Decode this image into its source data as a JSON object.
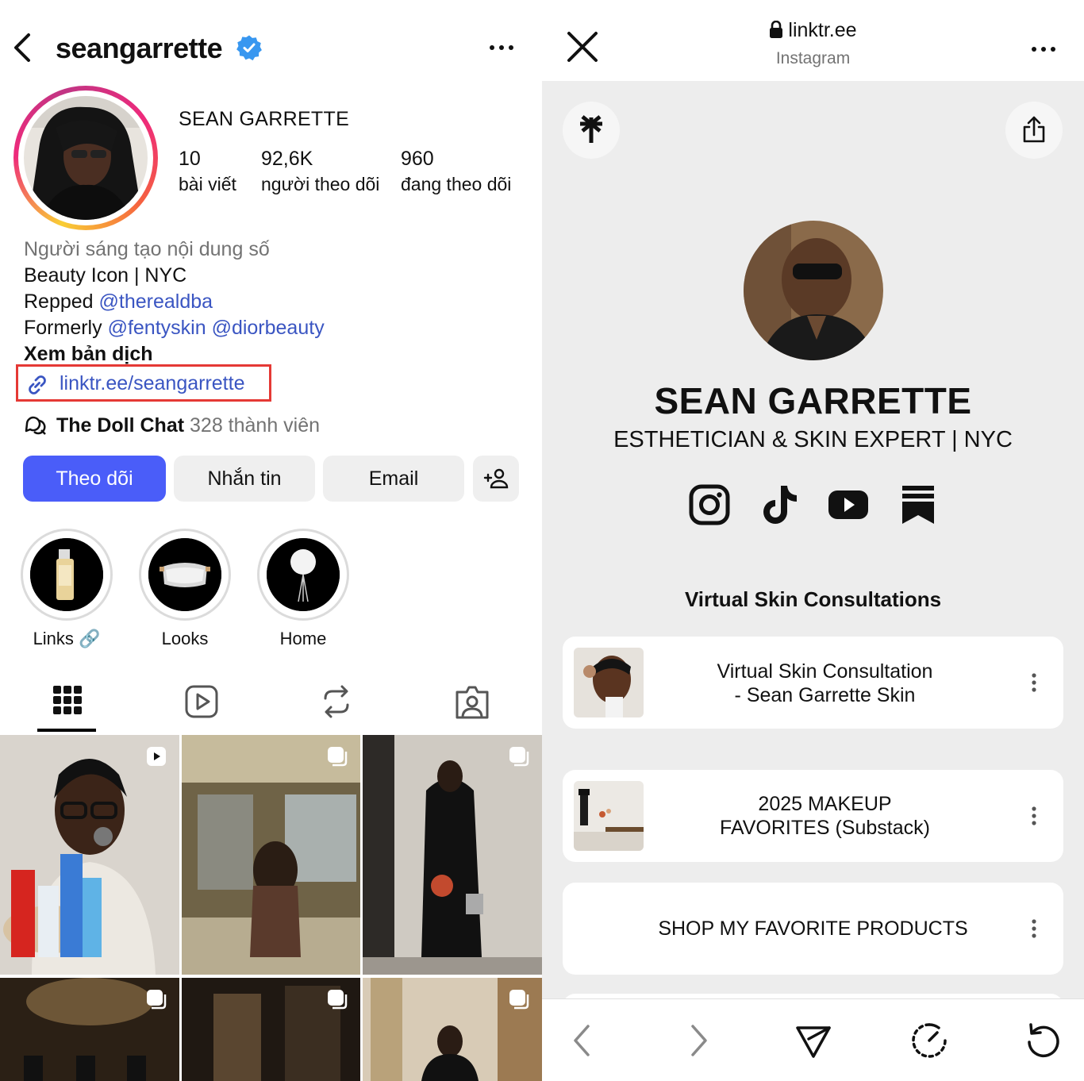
{
  "instagram": {
    "header": {
      "username": "seangarrette"
    },
    "profile": {
      "full_name": "SEAN GARRETTE",
      "stats": [
        {
          "value": "10",
          "label": "bài viết"
        },
        {
          "value": "92,6K",
          "label": "người theo dõi"
        },
        {
          "value": "960",
          "label": "đang theo dõi"
        }
      ],
      "bio": {
        "category": "Người sáng tạo nội dung số",
        "line1": "Beauty Icon | NYC",
        "line2_prefix": "Repped",
        "line2_mention": "@therealdba",
        "line3_prefix": "Formerly",
        "line3_mention1": "@fentyskin",
        "line3_mention2": "@diorbeauty",
        "translate": "Xem bản dịch"
      },
      "link": "linktr.ee/seangarrette",
      "channel": {
        "name": "The Doll Chat",
        "members": "328 thành viên"
      }
    },
    "buttons": {
      "follow": "Theo dõi",
      "message": "Nhắn tin",
      "email": "Email"
    },
    "highlights": [
      {
        "label": "Links 🔗"
      },
      {
        "label": "Looks"
      },
      {
        "label": "Home"
      }
    ]
  },
  "linktree": {
    "url": "linktr.ee",
    "source": "Instagram",
    "name": "SEAN GARRETTE",
    "tagline": "ESTHETICIAN & SKIN EXPERT | NYC",
    "social_icons": [
      "instagram-icon",
      "tiktok-icon",
      "youtube-icon",
      "substack-icon"
    ],
    "section_title": "Virtual Skin Consultations",
    "links": [
      {
        "title_line1": "Virtual Skin Consultation",
        "title_line2": "- Sean Garrette Skin"
      },
      {
        "title_line1": "2025 MAKEUP",
        "title_line2": "FAVORITES (Substack)"
      },
      {
        "title": "SHOP MY FAVORITE PRODUCTS"
      }
    ]
  },
  "colors": {
    "accent": "#4a5df9",
    "mention": "#3a55c2",
    "highlight_box": "#e53935",
    "verified": "#3897f0"
  }
}
